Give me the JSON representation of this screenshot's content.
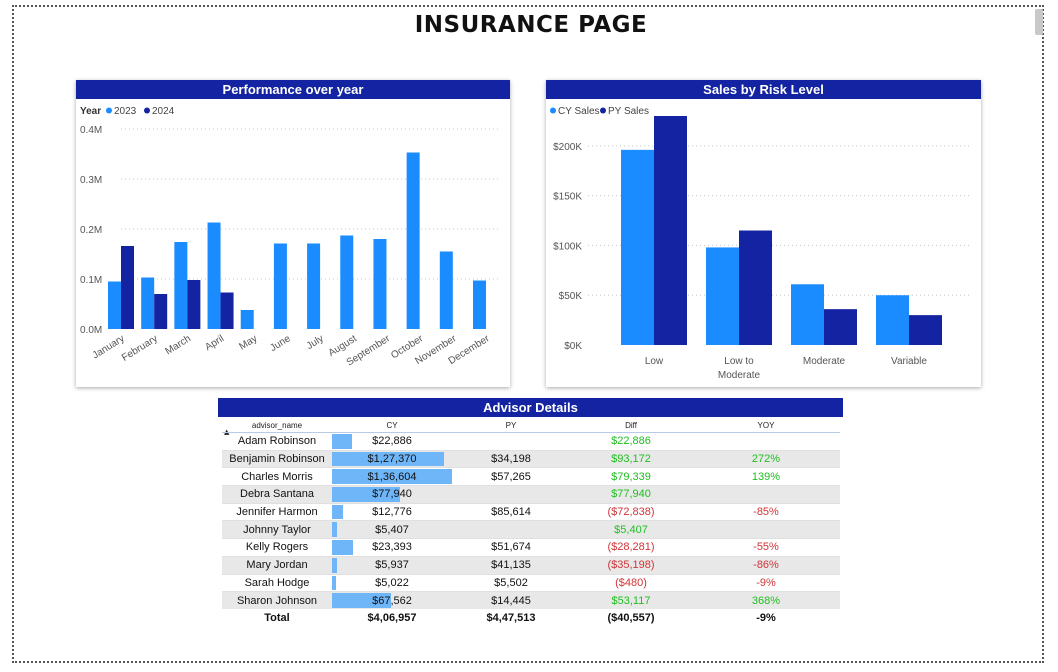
{
  "page": {
    "title": "INSURANCE PAGE"
  },
  "colors": {
    "primary": "#1323a1",
    "series_light": "#1a8cff",
    "series_dark": "#1323a1",
    "positive": "#1fbf1f",
    "negative": "#d13438",
    "cy_bar": "#6fb6f8"
  },
  "chart_data": [
    {
      "type": "bar",
      "title": "Performance over year",
      "legend_title": "Year",
      "legend_placement": "top-left",
      "categories": [
        "January",
        "February",
        "March",
        "April",
        "May",
        "June",
        "July",
        "August",
        "September",
        "October",
        "November",
        "December"
      ],
      "series": [
        {
          "name": "2023",
          "values": [
            0.095,
            0.103,
            0.174,
            0.213,
            0.038,
            0.171,
            0.171,
            0.187,
            0.18,
            0.353,
            0.155,
            0.097
          ]
        },
        {
          "name": "2024",
          "values": [
            0.166,
            0.07,
            0.098,
            0.073,
            null,
            null,
            null,
            null,
            null,
            null,
            null,
            null
          ]
        }
      ],
      "y_ticks": [
        "0.0M",
        "0.1M",
        "0.2M",
        "0.3M",
        "0.4M"
      ],
      "ylim": [
        0,
        0.4
      ],
      "units": "M",
      "grid": true
    },
    {
      "type": "bar",
      "title": "Sales by Risk Level",
      "legend_placement": "top-left",
      "categories": [
        "Low",
        "Low to Moderate",
        "Moderate",
        "Variable"
      ],
      "series": [
        {
          "name": "CY Sales",
          "values": [
            196000,
            98000,
            61000,
            50000
          ]
        },
        {
          "name": "PY Sales",
          "values": [
            230000,
            115000,
            36000,
            30000
          ]
        }
      ],
      "y_ticks": [
        "$0K",
        "$50K",
        "$100K",
        "$150K",
        "$200K"
      ],
      "ylim": [
        0,
        230000
      ],
      "grid": true
    }
  ],
  "advisor_table": {
    "title": "Advisor Details",
    "columns": [
      "advisor_name",
      "CY",
      "PY",
      "Diff",
      "YOY"
    ],
    "sort_icon": "sort-ascending-icon",
    "rows": [
      {
        "name": "Adam Robinson",
        "cy": "$22,886",
        "cy_value": 22886,
        "py": "",
        "diff": "$22,886",
        "diff_sign": "pos",
        "yoy": "",
        "yoy_sign": "pos"
      },
      {
        "name": "Benjamin Robinson",
        "cy": "$1,27,370",
        "cy_value": 127370,
        "py": "$34,198",
        "diff": "$93,172",
        "diff_sign": "pos",
        "yoy": "272%",
        "yoy_sign": "pos"
      },
      {
        "name": "Charles Morris",
        "cy": "$1,36,604",
        "cy_value": 136604,
        "py": "$57,265",
        "diff": "$79,339",
        "diff_sign": "pos",
        "yoy": "139%",
        "yoy_sign": "pos"
      },
      {
        "name": "Debra Santana",
        "cy": "$77,940",
        "cy_value": 77940,
        "py": "",
        "diff": "$77,940",
        "diff_sign": "pos",
        "yoy": "",
        "yoy_sign": "pos"
      },
      {
        "name": "Jennifer Harmon",
        "cy": "$12,776",
        "cy_value": 12776,
        "py": "$85,614",
        "diff": "($72,838)",
        "diff_sign": "neg",
        "yoy": "-85%",
        "yoy_sign": "neg"
      },
      {
        "name": "Johnny Taylor",
        "cy": "$5,407",
        "cy_value": 5407,
        "py": "",
        "diff": "$5,407",
        "diff_sign": "pos",
        "yoy": "",
        "yoy_sign": "pos"
      },
      {
        "name": "Kelly Rogers",
        "cy": "$23,393",
        "cy_value": 23393,
        "py": "$51,674",
        "diff": "($28,281)",
        "diff_sign": "neg",
        "yoy": "-55%",
        "yoy_sign": "neg"
      },
      {
        "name": "Mary Jordan",
        "cy": "$5,937",
        "cy_value": 5937,
        "py": "$41,135",
        "diff": "($35,198)",
        "diff_sign": "neg",
        "yoy": "-86%",
        "yoy_sign": "neg"
      },
      {
        "name": "Sarah Hodge",
        "cy": "$5,022",
        "cy_value": 5022,
        "py": "$5,502",
        "diff": "($480)",
        "diff_sign": "neg",
        "yoy": "-9%",
        "yoy_sign": "neg"
      },
      {
        "name": "Sharon Johnson",
        "cy": "$67,562",
        "cy_value": 67562,
        "py": "$14,445",
        "diff": "$53,117",
        "diff_sign": "pos",
        "yoy": "368%",
        "yoy_sign": "pos"
      }
    ],
    "total": {
      "label": "Total",
      "cy": "$4,06,957",
      "py": "$4,47,513",
      "diff": "($40,557)",
      "yoy": "-9%"
    }
  }
}
